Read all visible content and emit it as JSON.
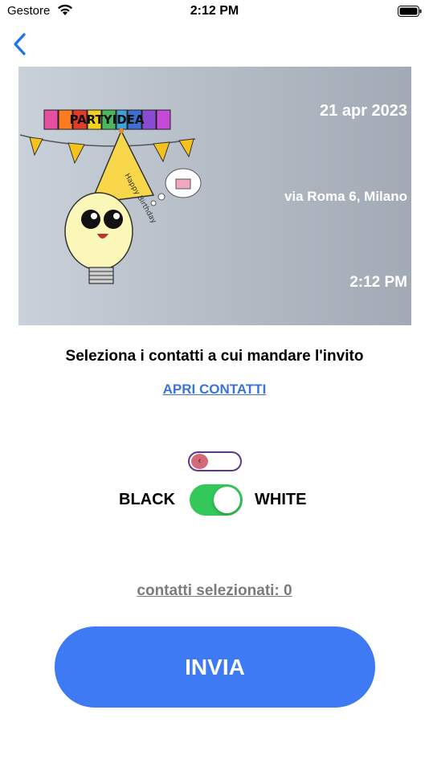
{
  "status_bar": {
    "carrier": "Gestore",
    "time": "2:12 PM"
  },
  "nav": {
    "back_icon": "chevron-left-icon"
  },
  "invite_card": {
    "logo_text": "PARTYIDEA",
    "hat_text": "Happy Birthday",
    "date": "21 apr 2023",
    "place": "via Roma 6, Milano",
    "time": "2:12 PM"
  },
  "contacts": {
    "prompt": "Seleziona i contatti a cui mandare l'invito",
    "open_link": "APRI CONTATTI",
    "selected_label": "contatti selezionati: 0"
  },
  "theme_toggle": {
    "small_switch_glyph": "‹",
    "left_label": "BLACK",
    "right_label": "WHITE",
    "is_on": true
  },
  "actions": {
    "send_label": "INVIA"
  },
  "colors": {
    "accent_blue": "#3e7af3",
    "link_blue": "#3b74d9",
    "switch_green": "#34c759",
    "banner_gray": "#b6bec8"
  }
}
